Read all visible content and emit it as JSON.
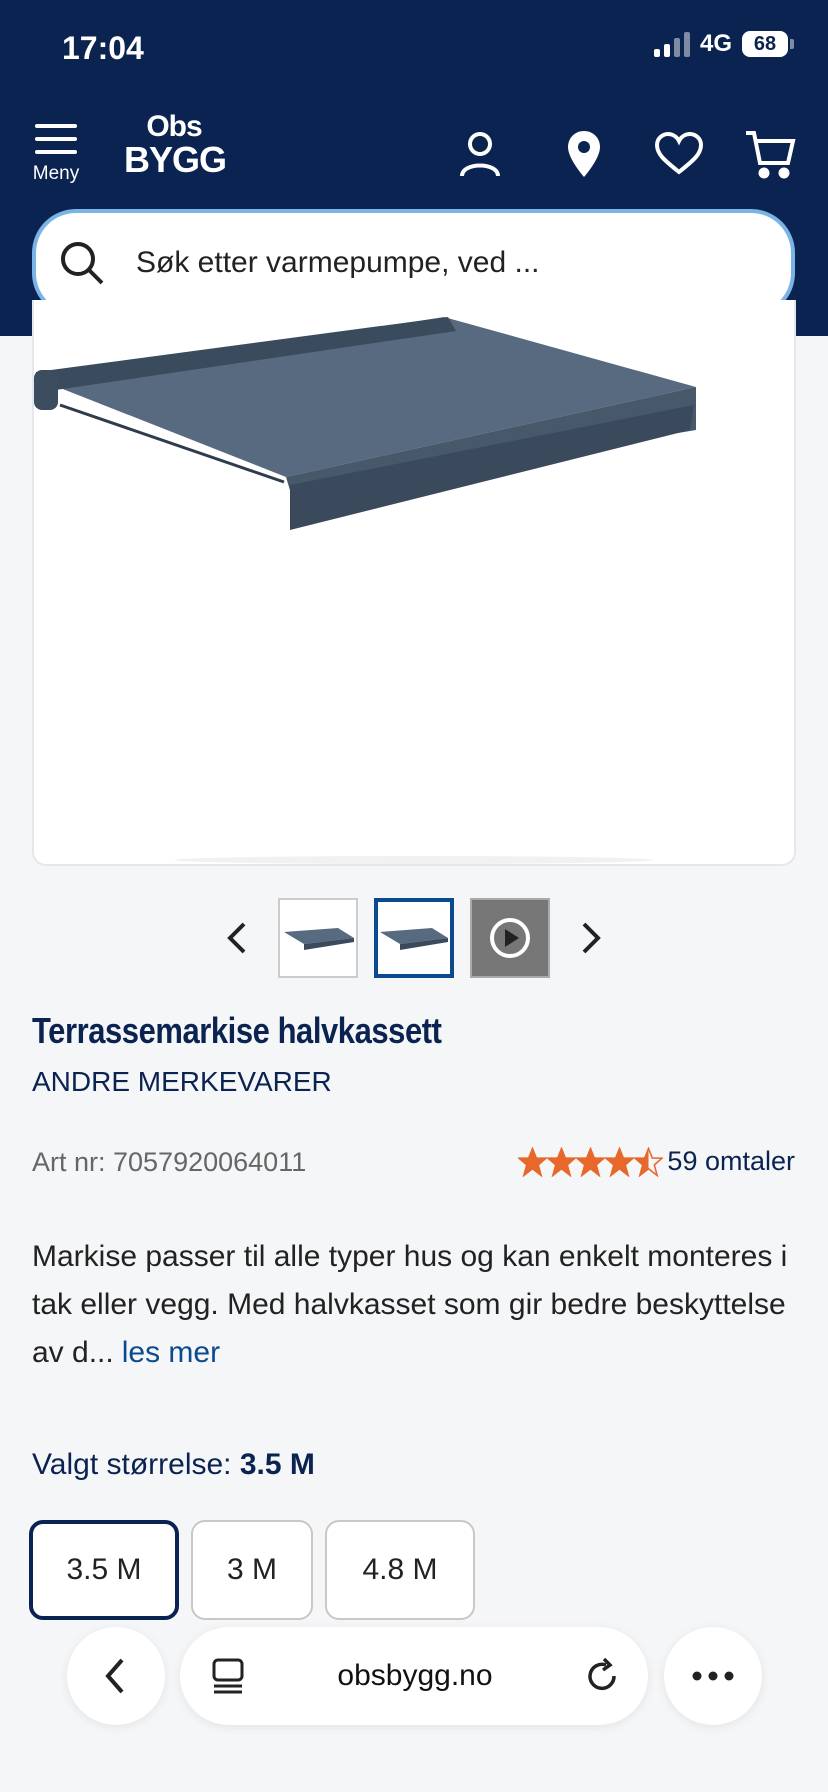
{
  "status_bar": {
    "time": "17:04",
    "network": "4G",
    "battery": "68"
  },
  "header": {
    "menu_label": "Meny",
    "logo_line1": "Obs",
    "logo_line2": "BYGG",
    "icons": [
      "account-icon",
      "location-pin-icon",
      "heart-icon",
      "cart-icon"
    ],
    "search_placeholder": "Søk etter varmepumpe, ved ..."
  },
  "product": {
    "title": "Terrassemarkise halvkassett",
    "brand": "ANDRE MERKEVARER",
    "art_label": "Art nr: 7057920064011",
    "rating": 4.5,
    "rating_max": 5,
    "reviews": "59 omtaler",
    "description": "Markise passer til alle typer hus og kan enkelt monteres i tak eller vegg. Med halvkasset som gir bedre beskyttelse av d...",
    "read_more": "les mer",
    "size_label": "Valgt størrelse:",
    "selected_size": "3.5 M",
    "sizes": [
      "3.5 M",
      "3 M",
      "4.8 M"
    ]
  },
  "browser": {
    "url": "obsbygg.no"
  },
  "colors": {
    "header_bg": "#0b2350",
    "accent": "#0b4a8f",
    "star": "#e8672a",
    "search_border": "#7ab4e6"
  }
}
